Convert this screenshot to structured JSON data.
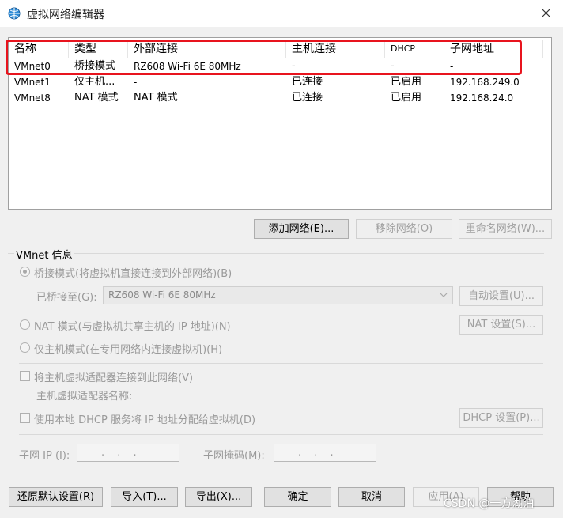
{
  "window": {
    "title": "虚拟网络编辑器",
    "icon": "network-globe-icon",
    "close_icon": "close-icon"
  },
  "network_list": {
    "columns": [
      "名称",
      "类型",
      "外部连接",
      "主机连接",
      "DHCP",
      "子网地址"
    ],
    "rows": [
      [
        "VMnet0",
        "桥接模式",
        "RZ608 Wi-Fi 6E 80MHz",
        "-",
        "-",
        "-"
      ],
      [
        "VMnet1",
        "仅主机...",
        "-",
        "已连接",
        "已启用",
        "192.168.249.0"
      ],
      [
        "VMnet8",
        "NAT 模式",
        "NAT 模式",
        "已连接",
        "已启用",
        "192.168.24.0"
      ]
    ],
    "highlight_color": "#e8141e"
  },
  "list_buttons": {
    "add": "添加网络(E)...",
    "remove": "移除网络(O)",
    "rename": "重命名网络(W)..."
  },
  "vmnet_info": {
    "group_label": "VMnet 信息",
    "bridged_label": "桥接模式(将虚拟机直接连接到外部网络)(B)",
    "bridged_to_label": "已桥接至(G):",
    "bridged_to_value": "RZ608 Wi-Fi 6E 80MHz",
    "auto_settings": "自动设置(U)...",
    "nat_label": "NAT 模式(与虚拟机共享主机的 IP 地址)(N)",
    "nat_settings": "NAT 设置(S)...",
    "hostonly_label": "仅主机模式(在专用网络内连接虚拟机)(H)",
    "connect_adapter_label": "将主机虚拟适配器连接到此网络(V)",
    "adapter_name_label": "主机虚拟适配器名称:",
    "dhcp_label": "使用本地 DHCP 服务将 IP 地址分配给虚拟机(D)",
    "dhcp_settings": "DHCP 设置(P)...",
    "subnet_ip_label": "子网 IP (I):",
    "subnet_ip_value": ". . .",
    "subnet_mask_label": "子网掩码(M):",
    "subnet_mask_value": ". . ."
  },
  "footer": {
    "restore": "还原默认设置(R)",
    "import": "导入(T)...",
    "export": "导出(X)...",
    "ok": "确定",
    "cancel": "取消",
    "apply": "应用(A)",
    "help": "帮助"
  },
  "watermark": "CSDN @一方湖泊"
}
